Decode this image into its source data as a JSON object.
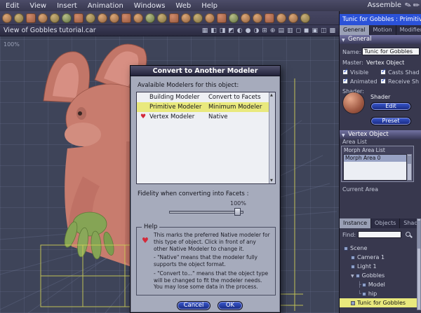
{
  "menu": {
    "items": [
      "Edit",
      "View",
      "Insert",
      "Animation",
      "Windows",
      "Web",
      "Help"
    ],
    "mode_label": "Assemble"
  },
  "toolbar": {
    "icons": [
      "select-tool",
      "move-tool",
      "rotate-tool",
      "scale-tool",
      "hand-tool",
      "zoom-tool",
      "camera-dolly",
      "camera-pan",
      "camera-track",
      "figure-object",
      "vertex-object",
      "spline-object",
      "text-object",
      "terrain-object",
      "metaball-object",
      "particle-emitter",
      "light-object",
      "camera-object",
      "primitive-cube",
      "primitive-sphere",
      "primitive-cone",
      "plant-object",
      "ocean-object",
      "cloud-object",
      "wizard-tool",
      "render-tool"
    ]
  },
  "viewport": {
    "title": "View of Gobbles tutorial.car",
    "zoom_level": "100%",
    "titlebar_icons": [
      "▦",
      "◧",
      "◨",
      "◩",
      "◐",
      "●",
      "◑",
      "⊞",
      "⊕",
      "▤",
      "▥",
      "◻",
      "◼",
      "▣",
      "◫",
      "▩"
    ]
  },
  "dialog": {
    "title": "Convert to Another Modeler",
    "intro": "Avalaible Modelers for this object:",
    "rows": [
      {
        "heart": "",
        "modeler": "Building Modeler",
        "mode": "Convert to Facets"
      },
      {
        "heart": "",
        "modeler": "Primitive Modeler",
        "mode": "Minimum Modeler"
      },
      {
        "heart": "♥",
        "modeler": "Vertex Modeler",
        "mode": "Native"
      }
    ],
    "fidelity_label": "Fidelity when converting into Facets :",
    "fidelity_value": "100%",
    "help_title": "Help",
    "help_heart": "♥",
    "help_p1": "This marks the preferred Native modeler for this type of object. Click in front of any other Native Modeler to change it.",
    "help_p2": "- \"Native\" means that the modeler fully supports the object format.",
    "help_p3": "- \"Convert to...\" means that the object type will be changed to fit the modeler needs. You may lose some data in the process.",
    "cancel_label": "Cancel",
    "ok_label": "OK"
  },
  "right_panel": {
    "header": "Tunic for Gobbles : Primitive",
    "tabs": [
      "General",
      "Motion",
      "Modifier"
    ],
    "general": {
      "section_label": "General",
      "name_label": "Name:",
      "name_value": "Tunic for Gobbles",
      "master_label": "Master:",
      "master_value": "Vertex Object",
      "check1": "Visible",
      "check2": "Casts Shad",
      "check3": "Animated",
      "check4": "Receive Sh",
      "shader_label": "Shader:",
      "shader_name": "Shader",
      "edit_label": "Edit",
      "preset_label": "Preset"
    },
    "vertex": {
      "section_label": "Vertex Object",
      "area_list_label": "Area List",
      "morph_list_label": "Morph Area List",
      "morph_item": "Morph Area 0",
      "current_area_label": "Current Area"
    },
    "browser": {
      "tabs": [
        "Instance",
        "Objects",
        "Shaders"
      ],
      "find_label": "Find:",
      "tree": [
        {
          "label": "Scene"
        },
        {
          "label": "Camera 1"
        },
        {
          "label": "Light 1"
        },
        {
          "label": "Gobbles"
        },
        {
          "label": "Model"
        },
        {
          "label": "hip"
        },
        {
          "label": "Tunic for Gobbles"
        }
      ]
    }
  }
}
